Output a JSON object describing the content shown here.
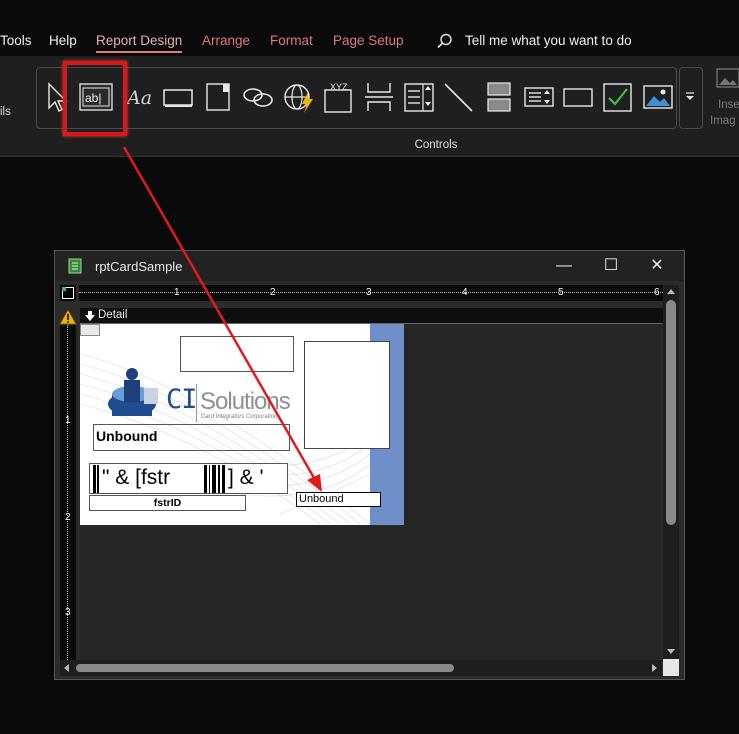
{
  "menu": {
    "items": [
      "Tools",
      "Help",
      "Report Design",
      "Arrange",
      "Format",
      "Page Setup"
    ],
    "search_text": "Tell me what you want to do"
  },
  "ribbon": {
    "group_label": "Controls",
    "left_cut_label": "ils",
    "right_cut_label_1": "Inse",
    "right_cut_label_2": "Imag",
    "icons": [
      "select-pointer-icon",
      "text-box-icon",
      "label-icon",
      "button-icon",
      "tab-control-icon",
      "hyperlink-icon",
      "web-browser-icon",
      "navigation-control-icon",
      "page-break-icon",
      "combo-box-icon",
      "line-icon",
      "toggle-button-icon",
      "list-box-icon",
      "rectangle-icon",
      "check-box-icon",
      "image-icon"
    ],
    "text_box_glyph": "ab|",
    "label_glyph": "Aa",
    "nav_glyph": "XYZ"
  },
  "report_window": {
    "title": "rptCardSample",
    "min_symbol": "—",
    "max_symbol": "☐",
    "close_symbol": "✕",
    "section": "Detail",
    "ruler_h": [
      "1",
      "2",
      "3",
      "4",
      "5",
      "6"
    ],
    "ruler_v": [
      "1",
      "2",
      "3"
    ],
    "corner_glyph": "...",
    "card": {
      "logo_ci": "CI",
      "logo_solutions": "Solutions",
      "logo_tag": "Card Integrators Corporation",
      "unbound_field": "Unbound",
      "barcode_expr": "\" & [fstr",
      "barcode_tail": "] & '",
      "fstrid_label": "fstrID",
      "new_textbox": "Unbound"
    }
  },
  "colors": {
    "accent": "#e07a7a",
    "highlight": "#d6171c",
    "card_edge": "#6f8fca",
    "arrow": "#e01b1b"
  }
}
